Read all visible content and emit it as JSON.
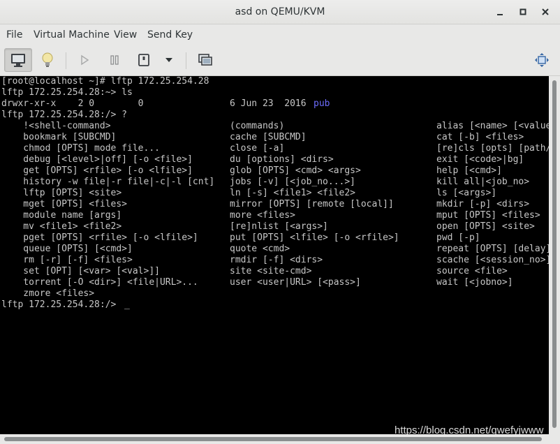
{
  "window": {
    "title": "asd on QEMU/KVM",
    "controls": {
      "minimize": "▁",
      "maximize": "▫",
      "close": "✕"
    }
  },
  "menu": [
    "File",
    "Virtual Machine",
    "View",
    "Send Key"
  ],
  "toolbar": {
    "buttons": [
      "console-view",
      "details-view",
      "run",
      "pause",
      "shutdown",
      "shutdown-menu",
      "snapshots",
      "fullscreen"
    ]
  },
  "terminal": {
    "lines": [
      [
        "[root@localhost ~]# lftp 172.25.254.28"
      ],
      [
        "lftp 172.25.254.28:~> ls"
      ],
      [
        "drwxr-xr-x    2 0        0",
        "6 Jun 23  2016 ",
        "pub"
      ],
      [
        "lftp 172.25.254.28:/> ?"
      ],
      [
        "    !<shell-command>",
        "(commands)",
        "alias [<name> [<value"
      ],
      [
        "    bookmark [SUBCMD]",
        "cache [SUBCMD]",
        "cat [-b] <files>"
      ],
      [
        "    chmod [OPTS] mode file...",
        "close [-a]",
        "[re]cls [opts] [path/"
      ],
      [
        "    debug [<level>|off] [-o <file>]",
        "du [options] <dirs>",
        "exit [<code>|bg]"
      ],
      [
        "    get [OPTS] <rfile> [-o <lfile>]",
        "glob [OPTS] <cmd> <args>",
        "help [<cmd>]"
      ],
      [
        "    history -w file|-r file|-c|-l [cnt]",
        "jobs [-v] [<job_no...>]",
        "kill all|<job_no>"
      ],
      [
        "    lftp [OPTS] <site>",
        "ln [-s] <file1> <file2>",
        "ls [<args>]"
      ],
      [
        "    mget [OPTS] <files>",
        "mirror [OPTS] [remote [local]]",
        "mkdir [-p] <dirs>"
      ],
      [
        "    module name [args]",
        "more <files>",
        "mput [OPTS] <files>"
      ],
      [
        "    mv <file1> <file2>",
        "[re]nlist [<args>]",
        "open [OPTS] <site>"
      ],
      [
        "    pget [OPTS] <rfile> [-o <lfile>]",
        "put [OPTS] <lfile> [-o <rfile>]",
        "pwd [-p]"
      ],
      [
        "    queue [OPTS] [<cmd>]",
        "quote <cmd>",
        "repeat [OPTS] [delay]"
      ],
      [
        "    rm [-r] [-f] <files>",
        "rmdir [-f] <dirs>",
        "scache [<session_no>]"
      ],
      [
        "    set [OPT] [<var> [<val>]]",
        "site <site-cmd>",
        "source <file>"
      ],
      [
        "    torrent [-O <dir>] <file|URL>...",
        "user <user|URL> [<pass>]",
        "wait [<jobno>]"
      ],
      [
        "    zmore <files>"
      ],
      [
        "lftp 172.25.254.28:/> ",
        "_"
      ]
    ]
  },
  "watermark": "https://blog.csdn.net/qwefyjwww"
}
